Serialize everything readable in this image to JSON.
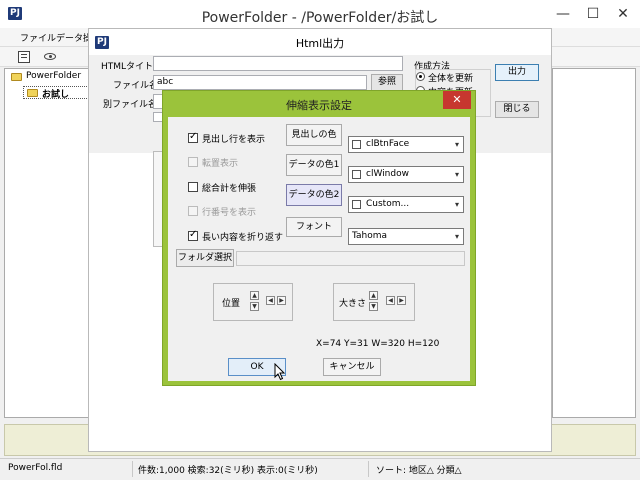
{
  "main": {
    "logo": "PJ",
    "title": "PowerFolder - /PowerFolder/お試し",
    "controls": {
      "minimize": "—",
      "maximize": "☐",
      "close": "✕"
    },
    "menu": [
      "ファイル",
      "データ操"
    ],
    "tree": {
      "root": "PowerFolder",
      "child": "お試し"
    },
    "status": {
      "file": "PowerFol.fld",
      "stats": "件数:1,000 検索:32(ミリ秒) 表示:0(ミリ秒)",
      "sort": "ソート: 地区△ 分類△"
    }
  },
  "html_dialog": {
    "logo": "PJ",
    "title": "Html出力",
    "html_title_label": "HTMLタイトル",
    "html_title_value": "",
    "filename_label": "ファイル名",
    "filename_value": "abc",
    "browse_label": "参照",
    "alt_filename_label": "別ファイル名",
    "method_label": "作成方法",
    "method_options": [
      "全体を更新",
      "内容を更新"
    ],
    "output_label": "出力",
    "close_label": "閉じる"
  },
  "expand_dialog": {
    "title": "伸縮表示設定",
    "close": "✕",
    "checkboxes": [
      {
        "label": "見出し行を表示",
        "checked": true,
        "enabled": true
      },
      {
        "label": "転置表示",
        "checked": false,
        "enabled": false
      },
      {
        "label": "総合計を伸張",
        "checked": false,
        "enabled": true
      },
      {
        "label": "行番号を表示",
        "checked": false,
        "enabled": false
      },
      {
        "label": "長い内容を折り返す",
        "checked": true,
        "enabled": true
      }
    ],
    "color_buttons": [
      "見出しの色",
      "データの色1",
      "データの色2"
    ],
    "color_selects": [
      "clBtnFace",
      "clWindow",
      "Custom..."
    ],
    "font_button": "フォント",
    "font_value": "Tahoma",
    "folder_select_label": "フォルダ選択",
    "folder_select_value": "",
    "position_label": "位置",
    "size_label": "大きさ",
    "geometry_text": "X=74 Y=31 W=320 H=120",
    "ok_label": "OK",
    "cancel_label": "キャンセル"
  }
}
